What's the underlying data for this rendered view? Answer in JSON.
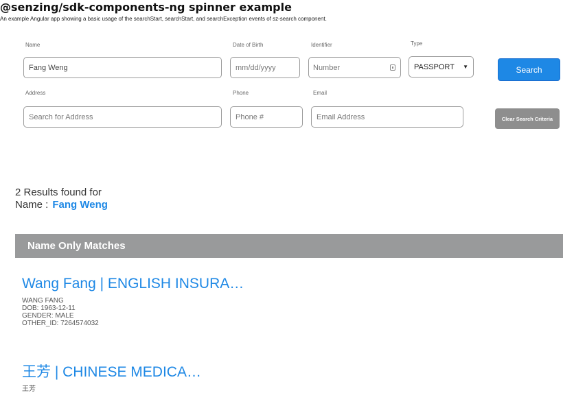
{
  "header": {
    "title": "@senzing/sdk-components-ng spinner example",
    "description": "An example Angular app showing a basic usage of the searchStart, searchStart, and searchException events of sz-search component."
  },
  "search_form": {
    "name": {
      "label": "Name",
      "value": "Fang Weng"
    },
    "dob": {
      "label": "Date of Birth",
      "placeholder": "mm/dd/yyyy"
    },
    "identifier": {
      "label": "Identifier",
      "placeholder": "Number",
      "icon": "id-card-icon"
    },
    "type": {
      "label": "Type",
      "selected": "PASSPORT",
      "arrow": "▼"
    },
    "search_button": "Search",
    "address": {
      "label": "Address",
      "placeholder": "Search for Address"
    },
    "phone": {
      "label": "Phone",
      "placeholder": "Phone #"
    },
    "email": {
      "label": "Email",
      "placeholder": "Email Address"
    },
    "clear_button": "Clear Search Criteria"
  },
  "results": {
    "summary": "2 Results found for",
    "query_label": "Name :",
    "query_value": "Fang Weng",
    "section_title": "Name Only Matches",
    "items": [
      {
        "title": "Wang Fang | ENGLISH INSURA…",
        "details": [
          "WANG FANG",
          "DOB: 1963-12-11",
          "GENDER: MALE",
          "OTHER_ID: 7264574032"
        ]
      },
      {
        "title": "王芳 | CHINESE MEDICA…",
        "details": [
          "王芳"
        ]
      }
    ]
  },
  "colors": {
    "accent": "#1e88e5",
    "section_header_bg": "#999a9b",
    "clear_button_bg": "#8e8e8e"
  }
}
